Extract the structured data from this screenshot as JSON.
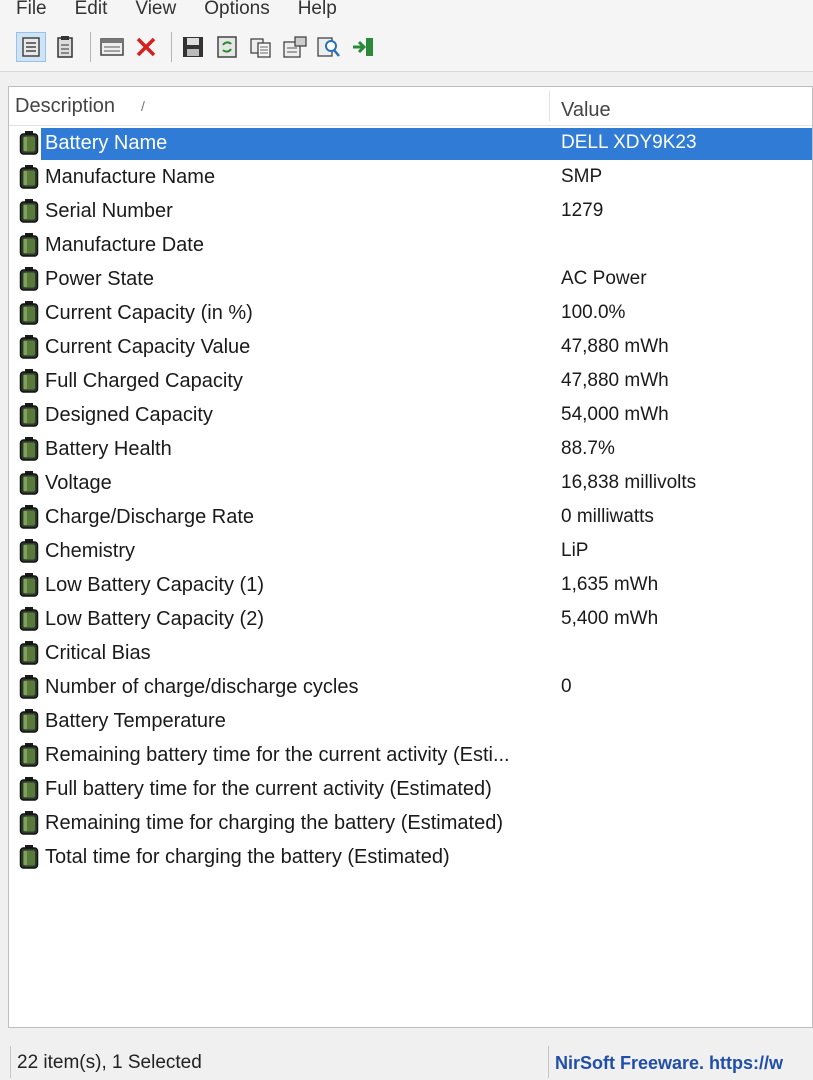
{
  "menu": [
    "File",
    "Edit",
    "View",
    "Options",
    "Help"
  ],
  "toolbar": {
    "buttons": [
      {
        "name": "view-details-button",
        "icon": "list-view-icon"
      },
      {
        "name": "view-report-button",
        "icon": "report-view-icon"
      },
      {
        "name": "properties-button",
        "icon": "window-icon"
      },
      {
        "name": "delete-button",
        "icon": "red-x-icon"
      },
      {
        "name": "save-button",
        "icon": "floppy-disk-icon"
      },
      {
        "name": "refresh-button",
        "icon": "refresh-icon"
      },
      {
        "name": "copy-button",
        "icon": "copy-icon"
      },
      {
        "name": "html-report-button",
        "icon": "report-icon"
      },
      {
        "name": "find-button",
        "icon": "find-icon"
      },
      {
        "name": "exit-button",
        "icon": "exit-icon"
      }
    ],
    "colors": {
      "delete": "#d62020",
      "accent": "#2f7bd6"
    }
  },
  "columns": {
    "description": "Description",
    "value": "Value"
  },
  "rows": [
    {
      "description": "Battery Name",
      "value": "DELL XDY9K23",
      "selected": true
    },
    {
      "description": "Manufacture Name",
      "value": "SMP"
    },
    {
      "description": "Serial Number",
      "value": "1279"
    },
    {
      "description": "Manufacture Date",
      "value": ""
    },
    {
      "description": "Power State",
      "value": "AC Power"
    },
    {
      "description": "Current Capacity (in %)",
      "value": "100.0%"
    },
    {
      "description": "Current Capacity Value",
      "value": "47,880 mWh"
    },
    {
      "description": "Full Charged Capacity",
      "value": "47,880 mWh"
    },
    {
      "description": "Designed Capacity",
      "value": "54,000 mWh"
    },
    {
      "description": "Battery Health",
      "value": "88.7%"
    },
    {
      "description": "Voltage",
      "value": "16,838 millivolts"
    },
    {
      "description": "Charge/Discharge Rate",
      "value": "0 milliwatts"
    },
    {
      "description": "Chemistry",
      "value": "LiP"
    },
    {
      "description": "Low Battery Capacity (1)",
      "value": "1,635 mWh"
    },
    {
      "description": "Low Battery Capacity (2)",
      "value": "5,400 mWh"
    },
    {
      "description": "Critical Bias",
      "value": ""
    },
    {
      "description": "Number of charge/discharge cycles",
      "value": "0"
    },
    {
      "description": "Battery Temperature",
      "value": ""
    },
    {
      "description": "Remaining battery time for the current activity (Esti...",
      "value": ""
    },
    {
      "description": "Full battery time for the current activity (Estimated)",
      "value": ""
    },
    {
      "description": "Remaining time for charging the battery (Estimated)",
      "value": ""
    },
    {
      "description": "Total  time for charging the battery (Estimated)",
      "value": ""
    }
  ],
  "row_icon": "battery-icon",
  "status": {
    "items": "22 item(s), 1 Selected",
    "credit": "NirSoft Freeware. https://w"
  }
}
